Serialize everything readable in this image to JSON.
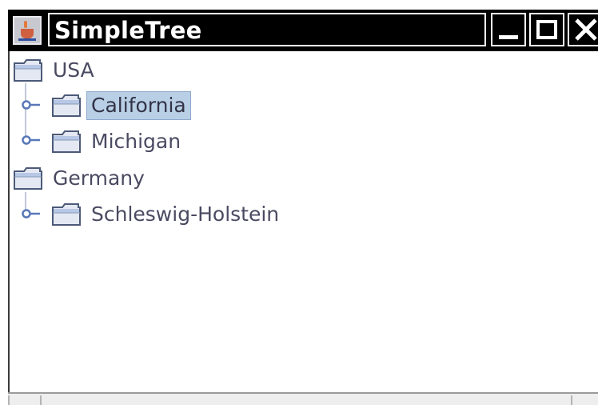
{
  "window": {
    "title": "SimpleTree",
    "icon": "java-cup-icon",
    "buttons": {
      "minimize": "minimize-icon",
      "maximize": "maximize-icon",
      "close": "close-icon"
    }
  },
  "tree": {
    "nodes": [
      {
        "label": "USA",
        "level": 0,
        "icon": "folder-icon",
        "expanded": true,
        "selected": false
      },
      {
        "label": "California",
        "level": 1,
        "icon": "folder-icon",
        "expanded": false,
        "selected": true
      },
      {
        "label": "Michigan",
        "level": 1,
        "icon": "folder-icon",
        "expanded": false,
        "selected": false
      },
      {
        "label": "Germany",
        "level": 0,
        "icon": "folder-icon",
        "expanded": true,
        "selected": false
      },
      {
        "label": "Schleswig-Holstein",
        "level": 1,
        "icon": "folder-icon",
        "expanded": false,
        "selected": false
      }
    ]
  },
  "colors": {
    "titlebar_bg": "#000000",
    "titlebar_text": "#ffffff",
    "selection_bg": "#b8cfe5",
    "selection_border": "#8fa9cc",
    "tree_text": "#4a4a62",
    "handle_color": "#5a78b8"
  }
}
